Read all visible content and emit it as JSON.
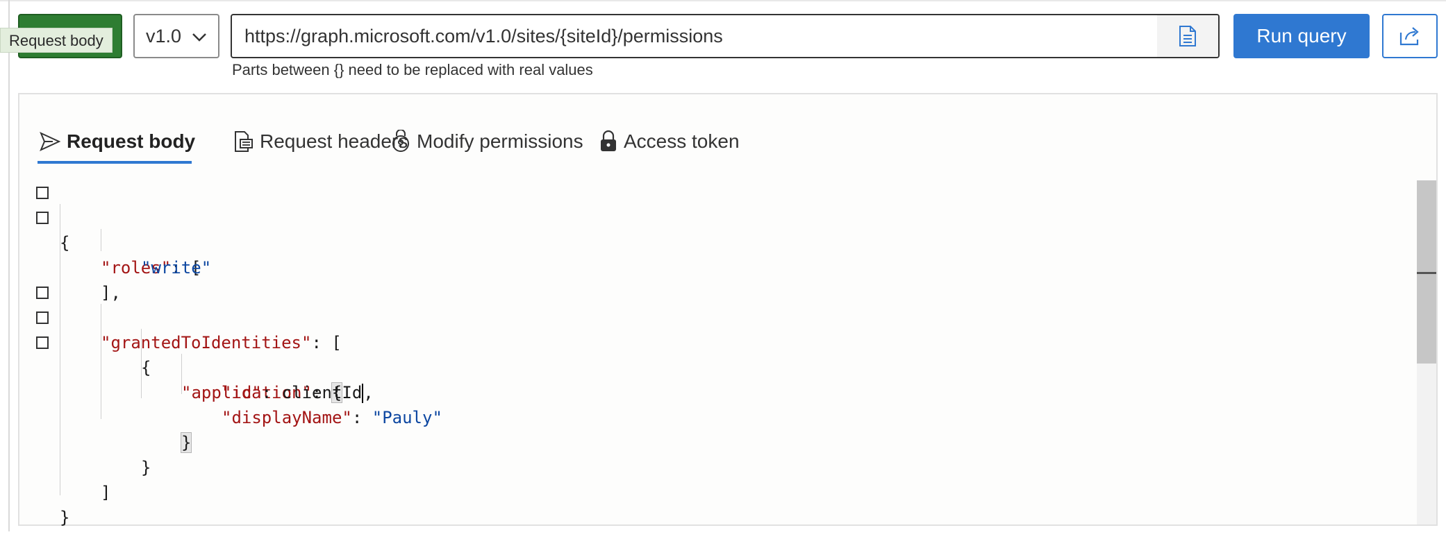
{
  "toolbar": {
    "method_tooltip": "Request body",
    "version": "v1.0",
    "url": "https://graph.microsoft.com/v1.0/sites/{siteId}/permissions",
    "run_label": "Run query",
    "hint": "Parts between {} need to be replaced with real values",
    "method_color": "#2e7d32",
    "accent": "#2f78d1"
  },
  "tabs": [
    {
      "label": "Request body",
      "icon": "send-icon",
      "active": true
    },
    {
      "label": "Request headers",
      "icon": "headers-icon",
      "active": false
    },
    {
      "label": "Modify permissions",
      "icon": "permissions-icon",
      "active": false
    },
    {
      "label": "Access token",
      "icon": "lock-icon",
      "active": false
    }
  ],
  "editor": {
    "lines": [
      {
        "t1": "{"
      },
      {
        "k": "\"roles\"",
        "t1": ": ["
      },
      {
        "s": "\"write\""
      },
      {
        "t1": "],"
      },
      {
        "k": "\"grantedToIdentities\"",
        "t1": ": ["
      },
      {
        "t1": "{"
      },
      {
        "k": "\"application\"",
        "t1": ": ",
        "b": "{"
      },
      {
        "k": "\"id\"",
        "t1": ": clientId",
        "t2": ","
      },
      {
        "k": "\"displayName\"",
        "t1": ": ",
        "s": "\"Pauly\""
      },
      {
        "b": "}"
      },
      {
        "t1": "}"
      },
      {
        "t1": "]"
      },
      {
        "t1": "}"
      }
    ]
  }
}
